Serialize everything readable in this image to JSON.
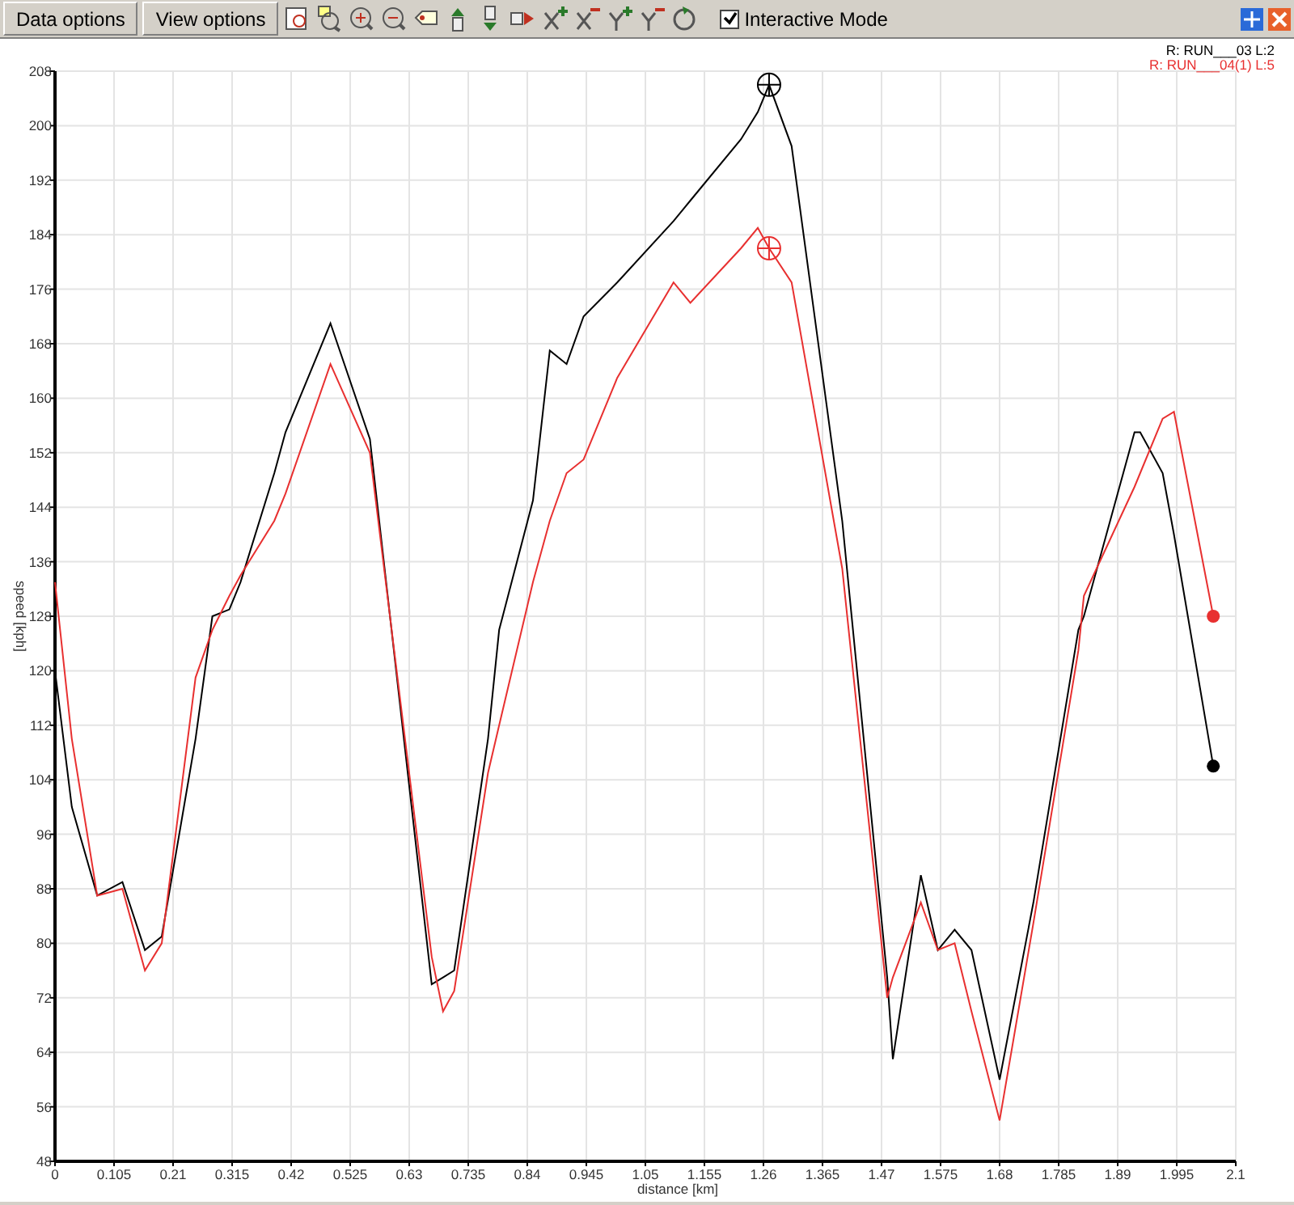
{
  "toolbar": {
    "buttons": [
      "Data options",
      "View options"
    ],
    "interactive_mode": {
      "label": "Interactive Mode",
      "checked": true
    }
  },
  "chart": {
    "chart_data": {
      "type": "line",
      "xlabel": "distance [km]",
      "ylabel": "speed [kph]",
      "x": [
        0,
        0.03,
        0.075,
        0.12,
        0.16,
        0.19,
        0.25,
        0.28,
        0.31,
        0.33,
        0.39,
        0.41,
        0.49,
        0.56,
        0.67,
        0.69,
        0.71,
        0.77,
        0.79,
        0.85,
        0.88,
        0.91,
        0.94,
        1.0,
        1.1,
        1.13,
        1.22,
        1.25,
        1.27,
        1.31,
        1.4,
        1.48,
        1.49,
        1.54,
        1.57,
        1.6,
        1.63,
        1.68,
        1.74,
        1.82,
        1.83,
        1.92,
        1.93,
        1.97,
        1.99,
        2.06
      ],
      "series": [
        {
          "name": "R: RUN___03  L:2",
          "color": "#000000",
          "values": [
            120,
            100,
            87,
            89,
            79,
            81,
            110,
            128,
            129,
            133,
            149,
            155,
            171,
            154,
            74,
            75,
            76,
            110,
            126,
            145,
            167,
            165,
            172,
            177,
            186,
            189,
            198,
            202,
            206,
            197,
            142,
            75,
            63,
            90,
            79,
            82,
            79,
            60,
            86,
            126,
            128,
            155,
            155,
            149,
            140,
            106
          ]
        },
        {
          "name": "R: RUN___04(1)  L:5",
          "color": "#e83030",
          "values": [
            133,
            110,
            87,
            88,
            76,
            80,
            119,
            126,
            131,
            134,
            142,
            146,
            165,
            152,
            78,
            70,
            73,
            105,
            112,
            133,
            142,
            149,
            151,
            163,
            177,
            174,
            182,
            185,
            182,
            177,
            135,
            72,
            75,
            86,
            79,
            80,
            70,
            54,
            83,
            123,
            131,
            147,
            149,
            157,
            158,
            128
          ]
        }
      ],
      "xlim": [
        0,
        2.1
      ],
      "ylim": [
        48,
        208
      ],
      "xticks": [
        0,
        0.105,
        0.21,
        0.315,
        0.42,
        0.525,
        0.63,
        0.735,
        0.84,
        0.945,
        1.05,
        1.155,
        1.26,
        1.365,
        1.47,
        1.575,
        1.68,
        1.785,
        1.89,
        1.995,
        2.1
      ],
      "yticks": [
        48,
        56,
        64,
        72,
        80,
        88,
        96,
        104,
        112,
        120,
        128,
        136,
        144,
        152,
        160,
        168,
        176,
        184,
        192,
        200,
        208
      ],
      "grid": true
    }
  }
}
